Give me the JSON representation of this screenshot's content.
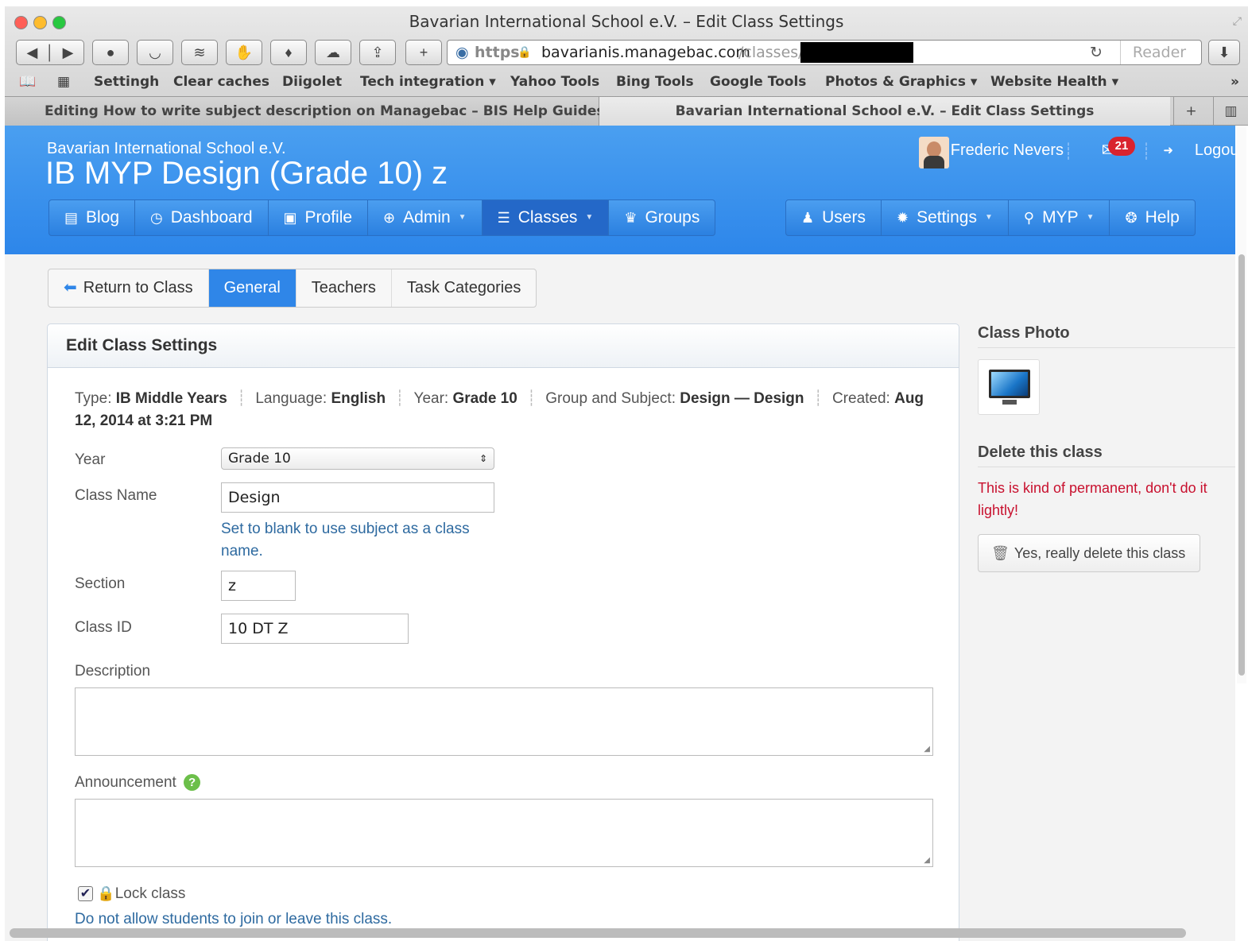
{
  "browser": {
    "window_title": "Bavarian International School e.V. – Edit Class Settings",
    "url_scheme": "https",
    "url_host": "bavarianis.managebac.com",
    "url_path": "/classes/",
    "reader_label": "Reader",
    "bookmarks": [
      "Settingh",
      "Clear caches",
      "Diigolet",
      "Tech integration ▾",
      "Yahoo Tools",
      "Bing Tools",
      "Google Tools",
      "Photos & Graphics ▾",
      "Website Health ▾"
    ],
    "overflow_chevron": "»",
    "tabs": [
      {
        "label": "Editing How to write subject description on Managebac – BIS Help Guides"
      },
      {
        "label": "Bavarian International School e.V. – Edit Class Settings"
      }
    ],
    "new_tab": "+"
  },
  "header": {
    "school_name": "Bavarian International School e.V.",
    "class_title": "IB MYP Design (Grade 10) z",
    "user_name": "Frederic Nevers",
    "message_count": "21",
    "logout_label": "Logout"
  },
  "nav": {
    "left": [
      {
        "label": "Blog",
        "icon": "blog-icon"
      },
      {
        "label": "Dashboard",
        "icon": "dashboard-icon"
      },
      {
        "label": "Profile",
        "icon": "profile-icon"
      },
      {
        "label": "Admin",
        "icon": "globe-icon"
      },
      {
        "label": "Classes",
        "icon": "classes-icon"
      },
      {
        "label": "Groups",
        "icon": "trophy-icon"
      }
    ],
    "right": [
      {
        "label": "Users",
        "icon": "user-icon"
      },
      {
        "label": "Settings",
        "icon": "gear-icon"
      },
      {
        "label": "MYP",
        "icon": "search-icon"
      },
      {
        "label": "Help",
        "icon": "lifebuoy-icon"
      }
    ]
  },
  "subtabs": {
    "return_label": "Return to Class",
    "general": "General",
    "teachers": "Teachers",
    "task_categories": "Task Categories"
  },
  "form": {
    "panel_title": "Edit Class Settings",
    "meta": {
      "type_label": "Type:",
      "type_value": "IB Middle Years",
      "language_label": "Language:",
      "language_value": "English",
      "year_label": "Year:",
      "year_value": "Grade 10",
      "group_label": "Group and Subject:",
      "group_value": "Design — Design",
      "created_label": "Created:",
      "created_value": "Aug 12, 2014 at 3:21 PM"
    },
    "year_label": "Year",
    "year_select": "Grade 10",
    "class_name_label": "Class Name",
    "class_name_value": "Design",
    "class_name_hint": "Set to blank to use subject as a class name.",
    "section_label": "Section",
    "section_value": "z",
    "class_id_label": "Class ID",
    "class_id_value": "10 DT Z",
    "description_label": "Description",
    "announcement_label": "Announcement",
    "help_icon": "?",
    "lock_label": "Lock class",
    "lock_hint": "Do not allow students to join or leave this class."
  },
  "sidebar": {
    "photo_title": "Class Photo",
    "delete_title": "Delete this class",
    "warning": "This is kind of permanent, don't do it lightly!",
    "delete_button": "Yes, really delete this class"
  }
}
